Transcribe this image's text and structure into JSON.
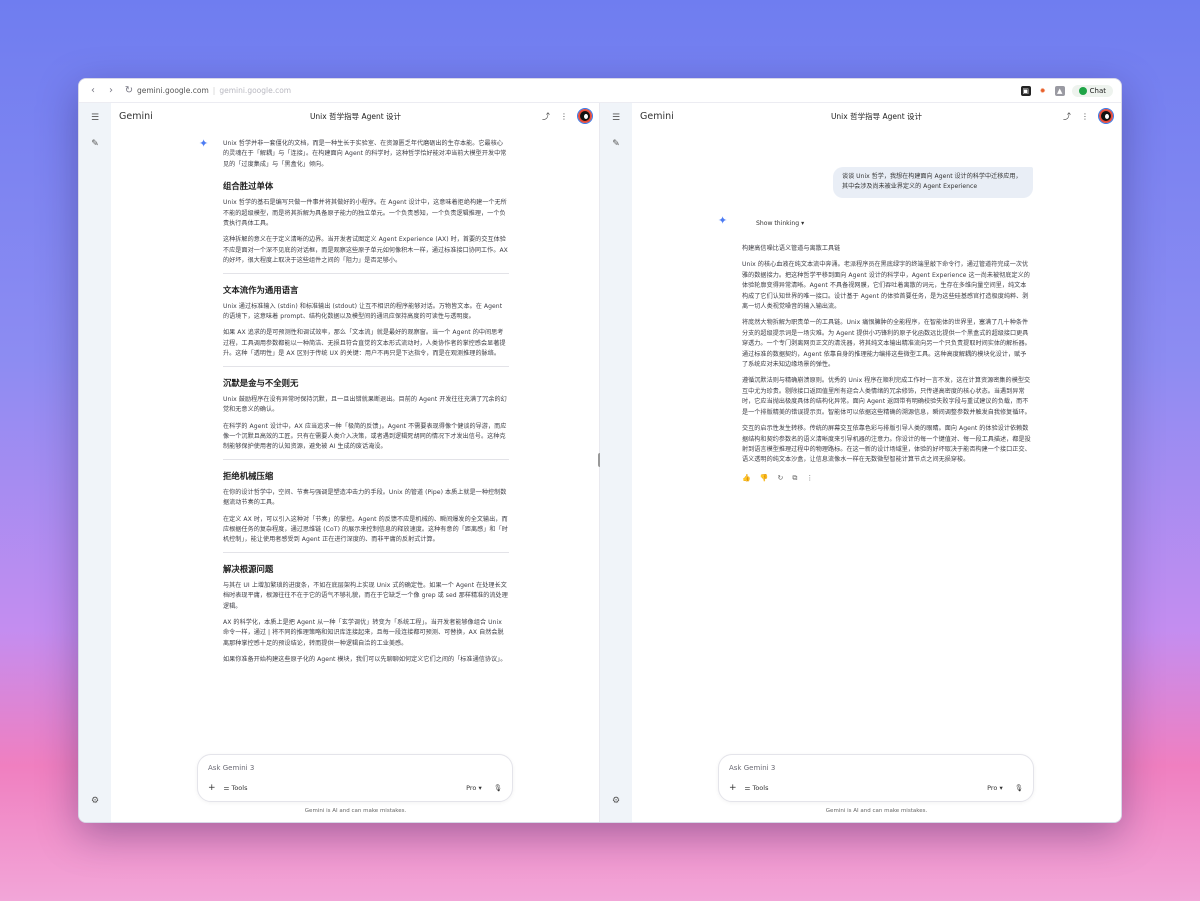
{
  "browser": {
    "url": "gemini.google.com",
    "url_dim": "gemini.google.com",
    "chat_label": "Chat"
  },
  "left": {
    "brand": "Gemini",
    "title": "Unix 哲学指导 Agent 设计",
    "intro": "Unix 哲学并非一套僵化的文档，而是一种生长于实验室、在资源匮乏年代磨砺出的生存本能。它最核心的灵魂在于「解耦」与「连接」。在构建面向 Agent 的科学时，这种哲学恰好能对冲当前大模型开发中常见的「过度集成」与「黑盒化」倾向。",
    "sections": [
      {
        "heading": "组合胜过单体",
        "paras": [
          "Unix 哲学的基石是编写只做一件事并将其做好的小程序。在 Agent 设计中，这意味着拒绝构建一个无所不能的超级模型，而是将其拆解为具备原子能力的独立单元。一个负责感知，一个负责逻辑推理，一个负责执行具体工具。",
          "这种拆解的意义在于定义清晰的边界。当开发者试图定义 Agent Experience (AX) 时，首要的交互体验不应是面对一个深不见底的对话框，而是观察这些原子单元如何像积木一样，通过标准接口协同工作。AX 的好坏，很大程度上取决于这些组件之间的「阻力」是否足够小。"
        ]
      },
      {
        "heading": "文本流作为通用语言",
        "paras": [
          "Unix 通过标准输入 (stdin) 和标准输出 (stdout) 让互不相识的程序能够对话。万物皆文本。在 Agent 的语境下，这意味着 prompt、结构化数据以及模型间的通讯应保持高度的可读性与透明度。",
          "如果 AX 追求的是可预测性和调试效率，那么「文本流」就是最好的观察窗。当一个 Agent 的中间思考过程，工具调用参数都能以一种简洁、无损且符合直觉的文本形式流动时，人类协作者的掌控感会显著提升。这种「透明性」是 AX 区别于传统 UX 的关键：用户不再只是下达指令，而是在观测推理的脉络。"
        ]
      },
      {
        "heading": "沉默是金与不全则无",
        "paras": [
          "Unix 鼓励程序在没有异常时保持沉默，且一旦出错就果断退出。目前的 Agent 开发往往充满了冗余的幻觉和无意义的确认。",
          "在科学的 Agent 设计中，AX 应当追求一种「极简的反馈」。Agent 不需要表现得像个健谈的导游，而应像一个沉默且高效的工匠。只有在需要人类介入决策，或者遇到逻辑死胡同的情况下才发出信号。这种克制能够保护使用者的认知资源，避免被 AI 生成的废话淹没。"
        ]
      },
      {
        "heading": "拒绝机械压缩",
        "paras": [
          "在你的设计哲学中，空间、节奏与强调是塑造冲击力的手段。Unix 的管道 (Pipe) 本质上就是一种控制数据流动节奏的工具。",
          "在定义 AX 时，可以引入这种对「节奏」的掌控。Agent 的反馈不应是机械的、瞬间爆发的全文输出，而应根据任务的复杂程度，通过思维链 (CoT) 的展示来控制信息的释放速度。这种有意的「距离感」和「时机控制」，能让使用者感受到 Agent 正在进行深度的、而非平庸的反射式计算。"
        ]
      },
      {
        "heading": "解决根源问题",
        "paras": [
          "与其在 UI 上增加繁琐的进度条，不如在底层架构上实现 Unix 式的确定性。如果一个 Agent 在处理长文档时表现平庸，根源往往不在于它的语气不够礼貌，而在于它缺乏一个像 grep 或 sed 那样精准的流处理逻辑。",
          "AX 的科学化，本质上是把 Agent 从一种「玄学调优」转变为「系统工程」。当开发者能够像组合 Unix 命令一样，通过 | 将不同的推理策略和知识库连接起来，且每一段连接都可预测、可替换，AX 自然会脱离那种掌控感十足的预设结论，转而提供一种逻辑自洽的工业美感。",
          "如果你准备开始构建这些原子化的 Agent 模块，我们可以先聊聊如何定义它们之间的「标准通信协议」。"
        ]
      }
    ]
  },
  "right": {
    "brand": "Gemini",
    "title": "Unix 哲学指导 Agent 设计",
    "user_message": "谈谈 Unix 哲学，我想在构建面向 Agent 设计的科学中迁移应用，其中会涉及尚未被业界定义的 Agent Experience",
    "show_thinking": "Show thinking",
    "response_heading": "构建高信噪比语义管道与离散工具链",
    "paras": [
      "Unix 的核心血液在纯文本流中奔涌。老派程序员在黑底绿字的终端里敲下命令行，通过管道符完成一次优雅的数据接力。把这种哲学平移到面向 Agent 设计的科学中，Agent Experience 这一尚未被彻底定义的体验轮廓变得异常清晰。Agent 不具备视网膜，它们吞吐着离散的词元，生存在多维向量空间里，纯文本构成了它们认知世界的唯一接口。设计基于 Agent 的体验首要任务，是为这些硅基感官打造极度纯粹、剥离一切人类视觉噪音的输入输出流。",
      "将庞然大物拆解为职责单一的工具链。Unix 痛恨臃肿的全能程序，在智能体的世界里，塞满了几十种条件分支的超级提示词是一场灾难。为 Agent 提供小巧锋利的原子化函数远比提供一个黑盒式的超级接口更具穿透力。一个专门剥离网页正文的清洗器，将其纯文本输出精准流向另一个只负责提取时间实体的解析器。通过标准的数据契约，Agent 依靠自身的推理能力编排这些微型工具。这种高度解耦的模块化设计，赋予了系统应对未知边缘场景的弹性。",
      "遵循沉默法则与精确崩溃原则。优秀的 Unix 程序在顺利完成工作时一言不发，这在计算资源密集的模型交互中尤为珍贵。剔除接口返回值里所有迎合人类情绪的冗余修饰，只传递高密度的核心状态。当遇到异常时，它应当抛出极度具体的结构化异常。面向 Agent 返回带有明确校验失败字段与重试建议的负载，而不是一个排版精美的错误提示页。智能体可以依据这些精确的溯源信息，瞬间调整参数并触发自我修复循环。",
      "交互的启示性发生转移。传统的屏幕交互依靠色彩与排版引导人类的眼睛。面向 Agent 的体验设计依赖数据结构和契约参数名的语义清晰度来引导机器的注意力。你设计的每一个键值对、每一段工具描述，都是投射到语言模型推理过程中的物理路标。在这一新的设计场域里，体验的好坏取决于能否构建一个接口正交、语义透明的纯文本沙盒，让信息流像水一样在无数微型智能计算节点之间无损穿梭。"
    ]
  },
  "input": {
    "placeholder": "Ask Gemini 3",
    "tools": "Tools",
    "mode": "Pro",
    "disclaimer": "Gemini is AI and can make mistakes."
  }
}
